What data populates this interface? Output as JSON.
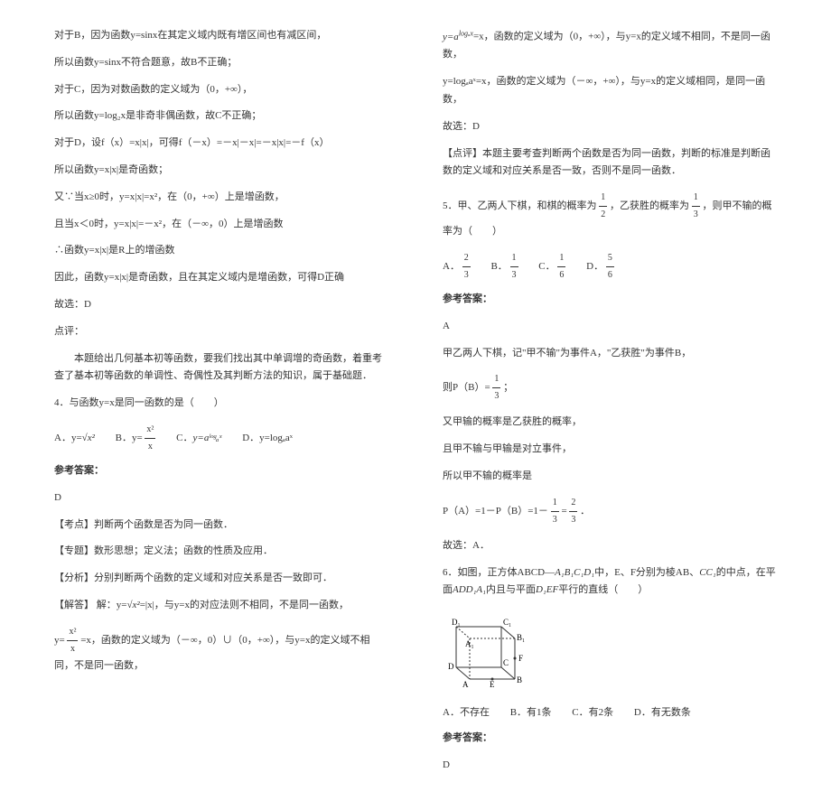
{
  "left": {
    "p1": "对于B，因为函数y=sinx在其定义域内既有增区间也有减区间，",
    "p2": "所以函数y=sinx不符合题意，故B不正确；",
    "p3": "对于C，因为对数函数的定义域为（0，+∞），",
    "p4": "所以函数y=log₂x是非奇非偶函数，故C不正确；",
    "p5": "对于D，设f（x）=x|x|，可得f（－x）=－x|－x|=－x|x|=－f（x）",
    "p6": "所以函数y=x|x|是奇函数；",
    "p7": "又∵当x≥0时，y=x|x|=x²，在（0，+∞）上是增函数，",
    "p8": "且当x＜0时，y=x|x|=－x²，在（－∞，0）上是增函数",
    "p9": "∴函数y=x|x|是R上的增函数",
    "p10": "因此，函数y=x|x|是奇函数，且在其定义域内是增函数，可得D正确",
    "p11": "故选：D",
    "p12_label": "点评：",
    "p12": "　　本题给出几何基本初等函数，要我们找出其中单调增的奇函数，着重考查了基本初等函数的单调性、奇偶性及其判断方法的知识，属于基础题．",
    "q4": "4．与函数y=x是同一函数的是（　　）",
    "q4_A_pre": "A．y=",
    "q4_B_pre": "B．y=",
    "q4_B_num": "x²",
    "q4_B_den": "x",
    "q4_C_pre": "C．",
    "q4_C": "y=aˡᵒᵍₐˣ",
    "q4_D": "D．y=logₐaˣ",
    "ans4_label": "参考答案：",
    "ans4": "D",
    "kp_label": "【考点】",
    "kp": "判断两个函数是否为同一函数．",
    "zt_label": "【专题】",
    "zt": "数形思想；定义法；函数的性质及应用．",
    "fx_label": "【分析】",
    "fx": "分别判断两个函数的定义域和对应关系是否一致即可．",
    "jd_label": "【解答】",
    "jd_pre": "解：y=",
    "jd_mid": "=|x|，与y=x的对应法则不相同，不是同一函数，",
    "jd2_pre": "y=",
    "jd2_num": "x²",
    "jd2_den": "x",
    "jd2": "=x，函数的定义域为（－∞，0）∪（0，+∞），与y=x的定义域不相同，不是同一函数，"
  },
  "right": {
    "p1_pre": "y=a",
    "p1_sup": "logₐx",
    "p1": "=x，函数的定义域为（0，+∞），与y=x的定义域不相同，不是同一函数，",
    "p2": "y=logₐaˣ=x，函数的定义域为（－∞，+∞），与y=x的定义域相同，是同一函数，",
    "p3": "故选：D",
    "dp_label": "【点评】",
    "dp": "本题主要考查判断两个函数是否为同一函数，判断的标准是判断函数的定义域和对应关系是否一致，否则不是同一函数．",
    "q5_pre": "5．甲、乙两人下棋，和棋的概率为",
    "q5_frac1_num": "1",
    "q5_frac1_den": "2",
    "q5_mid": "，乙获胜的概率为",
    "q5_frac2_num": "1",
    "q5_frac2_den": "3",
    "q5_post": "，则甲不输的概率为（　　）",
    "q5_A_pre": "A．",
    "q5_A_num": "2",
    "q5_A_den": "3",
    "q5_B_pre": "B．",
    "q5_B_num": "1",
    "q5_B_den": "3",
    "q5_C_pre": "C．",
    "q5_C_num": "1",
    "q5_C_den": "6",
    "q5_D_pre": "D．",
    "q5_D_num": "5",
    "q5_D_den": "6",
    "ans5_label": "参考答案：",
    "ans5": "A",
    "s5_1": "甲乙两人下棋，记\"甲不输\"为事件A，\"乙获胜\"为事件B，",
    "s5_2_pre": "则P（B）=",
    "s5_2_num": "1",
    "s5_2_den": "3",
    "s5_2_post": "；",
    "s5_3": "又甲输的概率是乙获胜的概率，",
    "s5_4": "且甲不输与甲输是对立事件，",
    "s5_5": "所以甲不输的概率是",
    "s5_6_pre": "P（A）=1－P（B）=1－",
    "s5_6_f1n": "1",
    "s5_6_f1d": "3",
    "s5_6_eq": "=",
    "s5_6_f2n": "2",
    "s5_6_f2d": "3",
    "s5_6_post": "．",
    "s5_7": "故选：A．",
    "q6_pre": "6．如图，正方体ABCD—",
    "q6_sub1": "A₁B₁C₁D₁",
    "q6_mid1": "中，E、F分别为棱AB、",
    "q6_sub2": "CC₁",
    "q6_mid2": "的中点，在平面",
    "q6_sub3": "ADD₁A₁",
    "q6_mid3": "内且与平面",
    "q6_sub4": "D₁EF",
    "q6_post": "平行的直线（　　）",
    "q6_A": "A．不存在",
    "q6_B": "B．有1条",
    "q6_C": "C．有2条",
    "q6_D": "D．有无数条",
    "ans6_label": "参考答案：",
    "ans6": "D",
    "cube": {
      "D1": "D₁",
      "C1": "C₁",
      "A1": "A₁",
      "B1": "B₁",
      "D": "D",
      "C": "C",
      "F": "F",
      "A": "A",
      "E": "E",
      "B": "B"
    }
  }
}
